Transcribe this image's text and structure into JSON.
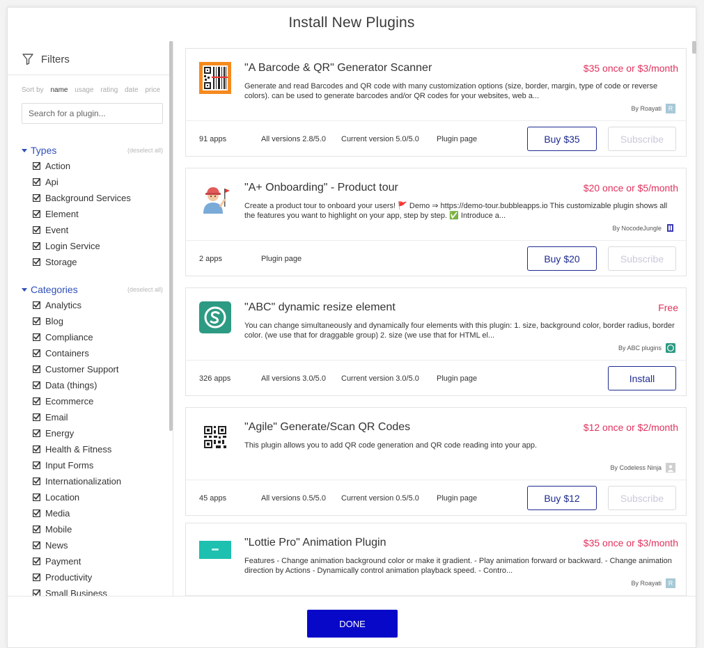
{
  "title": "Install New Plugins",
  "filters": {
    "label": "Filters",
    "sort_label": "Sort by",
    "sort_options": [
      "name",
      "usage",
      "rating",
      "date",
      "price"
    ],
    "search_placeholder": "Search for a plugin...",
    "types": {
      "label": "Types",
      "deselect": "(deselect all)",
      "items": [
        "Action",
        "Api",
        "Background Services",
        "Element",
        "Event",
        "Login Service",
        "Storage"
      ]
    },
    "categories": {
      "label": "Categories",
      "deselect": "(deselect all)",
      "items": [
        "Analytics",
        "Blog",
        "Compliance",
        "Containers",
        "Customer Support",
        "Data (things)",
        "Ecommerce",
        "Email",
        "Energy",
        "Health & Fitness",
        "Input Forms",
        "Internationalization",
        "Location",
        "Media",
        "Mobile",
        "News",
        "Payment",
        "Productivity",
        "Small Business"
      ]
    }
  },
  "plugins": [
    {
      "name": "\"A Barcode & QR\" Generator Scanner",
      "price": "$35 once or $3/month",
      "description": "Generate and read Barcodes and QR code with many customization options (size, border, margin, type of code or reverse colors). can be used to generate barcodes and/or QR codes for your websites, web a...",
      "author": "By Roayati",
      "apps": "91 apps",
      "all_versions": "All versions 2.8/5.0",
      "current_version": "Current version 5.0/5.0",
      "plugin_page": "Plugin page",
      "buy_label": "Buy $35",
      "subscribe_label": "Subscribe"
    },
    {
      "name": "\"A+ Onboarding\" - Product tour",
      "price": "$20 once or $5/month",
      "description": "Create a product tour to onboard your users! 🚩 Demo ⇒ https://demo-tour.bubbleapps.io This customizable plugin shows all the features you want to highlight on your app, step by step. ✅ Introduce a...",
      "author": "By NocodeJungle",
      "apps": "2 apps",
      "plugin_page": "Plugin page",
      "buy_label": "Buy $20",
      "subscribe_label": "Subscribe"
    },
    {
      "name": "\"ABC\" dynamic resize element",
      "price": "Free",
      "description": "You can change simultaneously and dynamically four elements with this plugin: 1. size, background color, border radius, border color. (we use that for draggable group) 2. size (we use that for HTML el...",
      "author": "By ABC plugins",
      "apps": "326 apps",
      "all_versions": "All versions 3.0/5.0",
      "current_version": "Current version 3.0/5.0",
      "plugin_page": "Plugin page",
      "install_label": "Install"
    },
    {
      "name": "\"Agile\" Generate/Scan QR Codes",
      "price": "$12 once or $2/month",
      "description": "This plugin allows you to add QR code generation and QR code reading into your app.",
      "author": "By Codeless Ninja",
      "apps": "45 apps",
      "all_versions": "All versions 0.5/5.0",
      "current_version": "Current version 0.5/5.0",
      "plugin_page": "Plugin page",
      "buy_label": "Buy $12",
      "subscribe_label": "Subscribe"
    },
    {
      "name": "\"Lottie Pro\" Animation Plugin",
      "price": "$35 once or $3/month",
      "description": "Features - Change animation background color or make it gradient. - Play animation forward or backward. - Change animation direction by Actions - Dynamically control animation playback speed. - Contro...",
      "author": "By Roayati"
    }
  ],
  "done_label": "DONE",
  "colors": {
    "accent_blue": "#2f4fb8",
    "price_red": "#e0315c",
    "done_button": "#0808c8",
    "button_border": "#1d2a8f"
  },
  "icons": {
    "filters": "funnel-icon",
    "checkbox": "checked-box-icon",
    "caret": "caret-down-icon"
  }
}
